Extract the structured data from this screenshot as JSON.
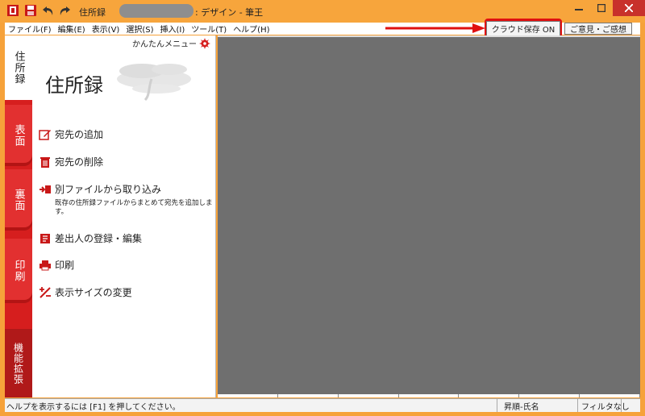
{
  "window": {
    "title_prefix": "住所録",
    "title_suffix": ": デザイン - 筆王"
  },
  "menu": {
    "items": [
      "ファイル(F)",
      "編集(E)",
      "表示(V)",
      "選択(S)",
      "挿入(I)",
      "ツール(T)",
      "ヘルプ(H)"
    ],
    "cloud_label": "クラウド保存 ON",
    "feedback_label": "ご意見・ご感想"
  },
  "tabs": [
    "住所録",
    "表面",
    "裏面",
    "印刷",
    "機能拡張"
  ],
  "panel": {
    "easy_menu": "かんたんメニュー",
    "title": "住所録",
    "actions": [
      "宛先の追加",
      "宛先の削除",
      "別ファイルから取り込み",
      "差出人の登録・編集",
      "印刷",
      "表示サイズの変更"
    ],
    "import_desc": "既存の住所録ファイルからまとめて宛先を追加します。"
  },
  "status": {
    "help": "ヘルプを表示するには [F1] を押してください。",
    "sort": "昇順-氏名",
    "filter": "フィルタなし"
  },
  "colors": {
    "window_frame": "#f7a53c",
    "tab_red": "#e23030",
    "main_gray": "#6f6f6f",
    "highlight": "#e01010"
  }
}
